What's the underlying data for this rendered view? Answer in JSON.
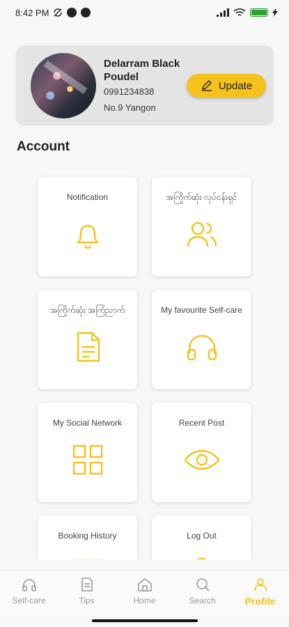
{
  "status_bar": {
    "time": "8:42 PM"
  },
  "profile": {
    "name": "Delarram Black Poudel",
    "phone": "0991234838",
    "address": "No.9 Yangon",
    "update_label": "Update"
  },
  "section_title": "Account",
  "tiles": [
    {
      "label": "Notification",
      "icon": "bell-icon"
    },
    {
      "label": "အကြိုက်ဆုံး လုပ်ငန်းရှင်",
      "icon": "users-icon"
    },
    {
      "label": "အကြိုက်ဆုံး အကြံညာက်",
      "icon": "document-icon"
    },
    {
      "label": "My favourite Self-care",
      "icon": "headphones-icon"
    },
    {
      "label": "My Social Network",
      "icon": "grid-icon"
    },
    {
      "label": "Recent Post",
      "icon": "eye-icon"
    },
    {
      "label": "Booking History",
      "icon": "history-icon"
    },
    {
      "label": "Log Out",
      "icon": "logout-icon"
    }
  ],
  "bottom_nav": [
    {
      "label": "Self-care",
      "icon": "headphones-icon"
    },
    {
      "label": "Tips",
      "icon": "document-icon"
    },
    {
      "label": "Home",
      "icon": "home-icon"
    },
    {
      "label": "Search",
      "icon": "search-icon"
    },
    {
      "label": "Profile",
      "icon": "person-icon",
      "active": true
    }
  ],
  "colors": {
    "accent": "#f5c21b",
    "inactive": "#9a9a9a",
    "card": "#e4e4e4"
  }
}
